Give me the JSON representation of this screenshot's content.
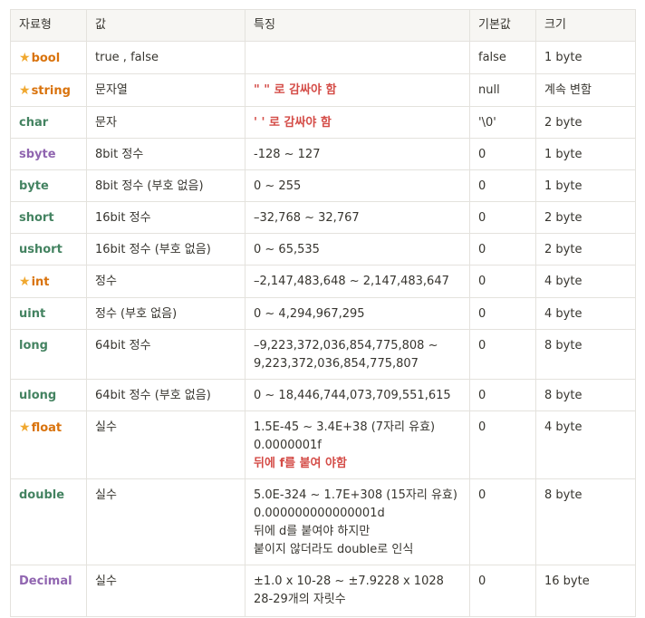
{
  "colors": {
    "green": "#448361",
    "orange": "#d9730d",
    "purple": "#9065b0",
    "red": "#d44c47",
    "star": "#f0a830"
  },
  "headers": [
    "자료형",
    "값",
    "특징",
    "기본값",
    "크기"
  ],
  "rows": [
    {
      "type": "bool",
      "star": true,
      "color": "orange",
      "value": "true , false",
      "features": [],
      "default": "false",
      "size": "1 byte"
    },
    {
      "type": "string",
      "star": true,
      "color": "orange",
      "value": "문자열",
      "features": [
        {
          "text": "\" \" 로 감싸야 함",
          "style": "red"
        }
      ],
      "default": "null",
      "size": "계속 변함"
    },
    {
      "type": "char",
      "star": false,
      "color": "green",
      "value": "문자",
      "features": [
        {
          "text": "' ' 로 감싸야 함",
          "style": "red"
        }
      ],
      "default": "'\\0'",
      "size": "2 byte"
    },
    {
      "type": "sbyte",
      "star": false,
      "color": "purple",
      "value": "8bit 정수",
      "features": [
        {
          "text": "-128 ~ 127"
        }
      ],
      "default": "0",
      "size": "1 byte"
    },
    {
      "type": "byte",
      "star": false,
      "color": "green",
      "value": "8bit 정수 (부호 없음)",
      "features": [
        {
          "text": "0 ~ 255"
        }
      ],
      "default": "0",
      "size": "1 byte"
    },
    {
      "type": "short",
      "star": false,
      "color": "green",
      "value": "16bit 정수",
      "features": [
        {
          "text": "–32,768 ~ 32,767"
        }
      ],
      "default": "0",
      "size": "2 byte"
    },
    {
      "type": "ushort",
      "star": false,
      "color": "green",
      "value": "16bit 정수 (부호 없음)",
      "features": [
        {
          "text": "0 ~ 65,535"
        }
      ],
      "default": "0",
      "size": "2 byte"
    },
    {
      "type": "int",
      "star": true,
      "color": "orange",
      "value": "정수",
      "features": [
        {
          "text": "–2,147,483,648 ~ 2,147,483,647"
        }
      ],
      "default": "0",
      "size": "4 byte"
    },
    {
      "type": "uint",
      "star": false,
      "color": "green",
      "value": "정수 (부호 없음)",
      "features": [
        {
          "text": "0 ~ 4,294,967,295"
        }
      ],
      "default": "0",
      "size": "4 byte"
    },
    {
      "type": "long",
      "star": false,
      "color": "green",
      "value": "64bit 정수",
      "features": [
        {
          "text": "–9,223,372,036,854,775,808 ~"
        },
        {
          "text": "9,223,372,036,854,775,807"
        }
      ],
      "default": "0",
      "size": "8 byte"
    },
    {
      "type": "ulong",
      "star": false,
      "color": "green",
      "value": "64bit 정수 (부호 없음)",
      "features": [
        {
          "text": "0 ~ 18,446,744,073,709,551,615"
        }
      ],
      "default": "0",
      "size": "8 byte"
    },
    {
      "type": "float",
      "star": true,
      "color": "orange",
      "value": "실수",
      "features": [
        {
          "text": "1.5E-45 ~ 3.4E+38 (7자리 유효)"
        },
        {
          "text": "0.0000001f"
        },
        {
          "text": "뒤에 f를 붙여 야함",
          "style": "red"
        }
      ],
      "default": "0",
      "size": "4 byte"
    },
    {
      "type": "double",
      "star": false,
      "color": "green",
      "value": "실수",
      "features": [
        {
          "text": "5.0E-324 ~ 1.7E+308 (15자리 유효)"
        },
        {
          "text": "0.000000000000001d"
        },
        {
          "text": "뒤에 d를 붙여야 하지만"
        },
        {
          "text": "붙이지 않더라도 double로 인식"
        }
      ],
      "default": "0",
      "size": "8 byte"
    },
    {
      "type": "Decimal",
      "star": false,
      "color": "purple",
      "value": "실수",
      "features": [
        {
          "text": "±1.0 x 10-28 ~ ±7.9228 x 1028"
        },
        {
          "text": "28-29개의 자릿수"
        }
      ],
      "default": "0",
      "size": "16 byte"
    }
  ]
}
